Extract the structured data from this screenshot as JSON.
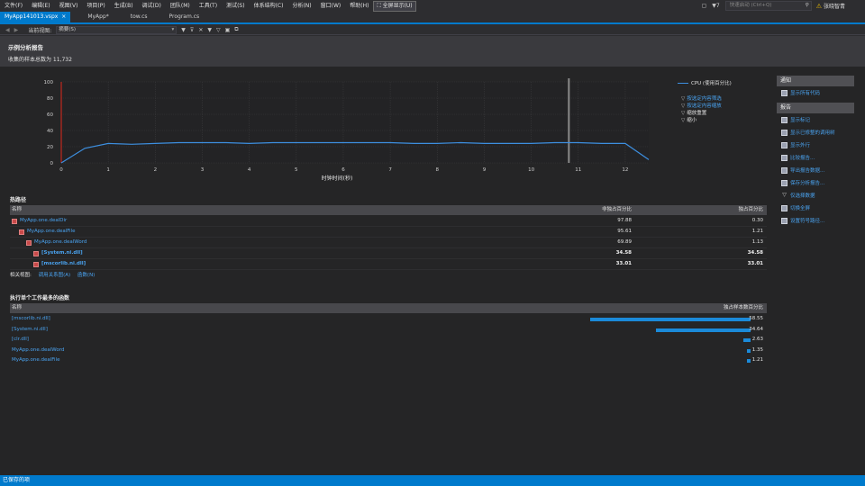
{
  "menu": {
    "items": [
      "文件(F)",
      "编辑(E)",
      "视图(V)",
      "项目(P)",
      "生成(B)",
      "调试(D)",
      "团队(M)",
      "工具(T)",
      "测试(S)",
      "体系结构(C)",
      "分析(N)",
      "窗口(W)",
      "帮助(H)"
    ],
    "fullscreen": "全屏显示(U)",
    "notifications": "7",
    "quick_launch_placeholder": "快速启动 (Ctrl+Q)",
    "user": "张晓智青"
  },
  "tabs": [
    {
      "label": "MyApp141013.vspx",
      "active": true,
      "close": "×"
    },
    {
      "label": "MyApp*",
      "active": false
    },
    {
      "label": "tow.cs",
      "active": false
    },
    {
      "label": "Program.cs",
      "active": false
    }
  ],
  "toolbar": {
    "current_view_label": "当前视图:",
    "current_view_value": "摘要(S)"
  },
  "report": {
    "title": "示例分析报告",
    "sample_count": "收集的样本总数为 11,732"
  },
  "chart_data": {
    "type": "line",
    "title": "",
    "xlabel": "时钟时间(秒)",
    "ylabel": "",
    "xlim": [
      0,
      12.5
    ],
    "ylim": [
      0,
      100
    ],
    "xticks": [
      "0",
      "1",
      "2",
      "3",
      "4",
      "5",
      "6",
      "7",
      "8",
      "9",
      "10",
      "11",
      "12"
    ],
    "yticks": [
      "0",
      "20",
      "40",
      "60",
      "80",
      "100"
    ],
    "series": [
      {
        "name": "CPU (使用百分比)",
        "color": "#3d8fe0",
        "x": [
          0,
          0.5,
          1,
          1.5,
          2,
          2.5,
          3,
          3.5,
          4,
          4.5,
          5,
          5.5,
          6,
          6.5,
          7,
          7.5,
          8,
          8.5,
          9,
          9.5,
          10,
          10.5,
          11,
          11.5,
          12,
          12.5
        ],
        "y": [
          0,
          18,
          24,
          23,
          24,
          25,
          25,
          25,
          24,
          25,
          25,
          25,
          25,
          25,
          25,
          24,
          24,
          25,
          24,
          24,
          24,
          25,
          25,
          24,
          24,
          4
        ]
      }
    ],
    "markers": {
      "selection_start": 0,
      "selection_line": 10.8
    },
    "grid": true,
    "legend_position": "right"
  },
  "legend": {
    "series_label": "CPU (使用百分比)",
    "filters": [
      {
        "label": "按选定内容筛选",
        "link": true
      },
      {
        "label": "按选定内容缩放",
        "link": true
      },
      {
        "label": "缩放重置",
        "link": false
      },
      {
        "label": "缩小",
        "link": false
      }
    ]
  },
  "side": {
    "notify_header": "通知",
    "notify_items": [
      "显示所有代码"
    ],
    "report_header": "报告",
    "report_items": [
      "显示标记",
      "显示已修整的调用树",
      "显示外行",
      "比较报告...",
      "导出报告数据...",
      "保存分析报告...",
      "仅选择数据",
      "切换全屏",
      "设置符号路径..."
    ]
  },
  "hot_path": {
    "title": "热路径",
    "col_name": "名称",
    "col_inclusive": "非独占百分比",
    "col_exclusive": "独占百分比",
    "rows": [
      {
        "name": "MyApp.one.dealDir",
        "incl": "97.88",
        "excl": "0.30"
      },
      {
        "name": "MyApp.one.dealFile",
        "incl": "95.61",
        "excl": "1.21"
      },
      {
        "name": "MyApp.one.dealWord",
        "incl": "69.89",
        "excl": "1.13"
      },
      {
        "name": "[System.ni.dll]",
        "incl": "34.58",
        "excl": "34.58"
      },
      {
        "name": "[mscorlib.ni.dll]",
        "incl": "33.01",
        "excl": "33.01"
      }
    ],
    "related_label": "相关视图:",
    "related_links": [
      "调用关系图(A)",
      "函数(N)"
    ]
  },
  "functions": {
    "title": "执行单个工作最多的函数",
    "col_name": "名称",
    "col_exclusive": "独占样本数百分比",
    "rows": [
      {
        "name": "[mscorlib.ni.dll]",
        "value": 58.55,
        "label": "58.55"
      },
      {
        "name": "[System.ni.dll]",
        "value": 34.64,
        "label": "34.64"
      },
      {
        "name": "[clr.dll]",
        "value": 2.63,
        "label": "2.63"
      },
      {
        "name": "MyApp.one.dealWord",
        "value": 1.35,
        "label": "1.35"
      },
      {
        "name": "MyApp.one.dealFile",
        "value": 1.21,
        "label": "1.21"
      }
    ]
  },
  "status": {
    "text": "已保存的项"
  }
}
